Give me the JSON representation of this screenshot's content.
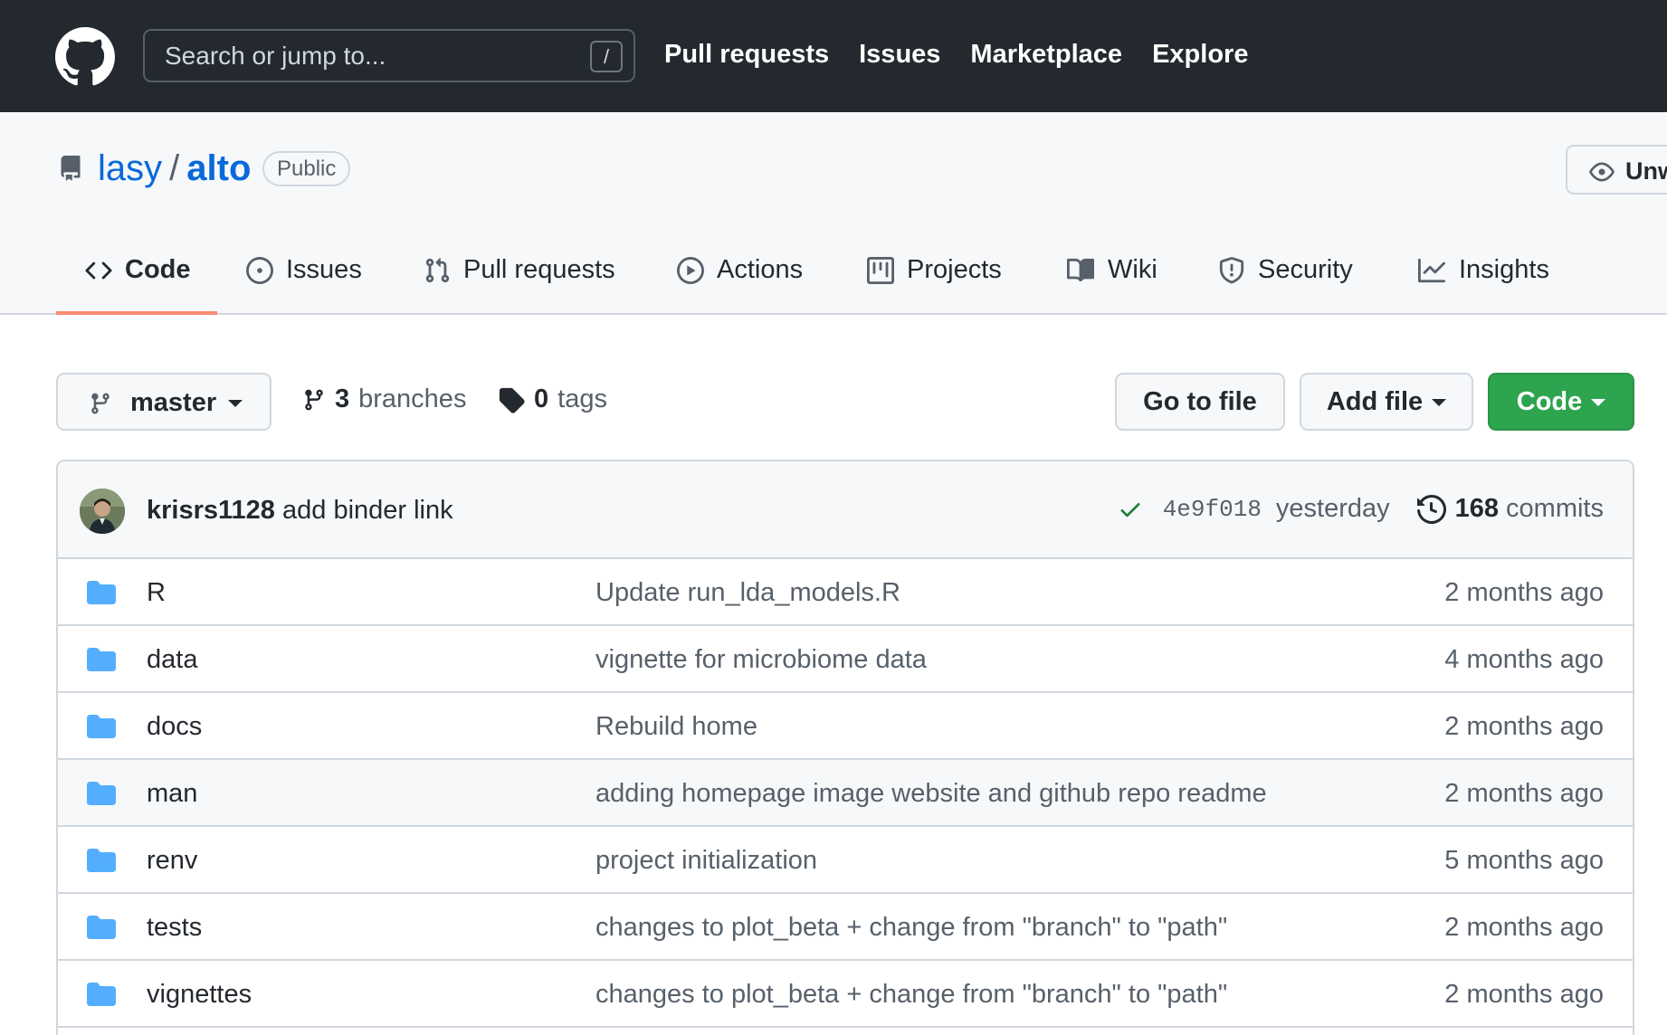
{
  "header": {
    "search_placeholder": "Search or jump to...",
    "search_shortcut": "/",
    "nav": [
      "Pull requests",
      "Issues",
      "Marketplace",
      "Explore"
    ]
  },
  "repo": {
    "owner": "lasy",
    "separator": "/",
    "name": "alto",
    "visibility": "Public",
    "watch_label": "Unwatch"
  },
  "tabs": [
    {
      "label": "Code",
      "icon": "code-icon",
      "selected": true
    },
    {
      "label": "Issues",
      "icon": "issue-opened-icon"
    },
    {
      "label": "Pull requests",
      "icon": "git-pull-request-icon"
    },
    {
      "label": "Actions",
      "icon": "play-icon"
    },
    {
      "label": "Projects",
      "icon": "project-icon"
    },
    {
      "label": "Wiki",
      "icon": "book-icon"
    },
    {
      "label": "Security",
      "icon": "shield-icon"
    },
    {
      "label": "Insights",
      "icon": "graph-icon"
    }
  ],
  "file_nav": {
    "branch": "master",
    "branches_count": "3",
    "branches_label": "branches",
    "tags_count": "0",
    "tags_label": "tags",
    "go_to_file": "Go to file",
    "add_file": "Add file",
    "code": "Code"
  },
  "latest_commit": {
    "author": "krisrs1128",
    "message": "add binder link",
    "status": "success",
    "sha": "4e9f018",
    "when": "yesterday",
    "commits_count": "168",
    "commits_label": "commits"
  },
  "files": [
    {
      "name": "R",
      "message": "Update run_lda_models.R",
      "age": "2 months ago"
    },
    {
      "name": "data",
      "message": "vignette for microbiome data",
      "age": "4 months ago"
    },
    {
      "name": "docs",
      "message": "Rebuild home",
      "age": "2 months ago"
    },
    {
      "name": "man",
      "message": "adding homepage image website and github repo readme",
      "age": "2 months ago"
    },
    {
      "name": "renv",
      "message": "project initialization",
      "age": "5 months ago"
    },
    {
      "name": "tests",
      "message": "changes to plot_beta + change from \"branch\" to \"path\"",
      "age": "2 months ago"
    },
    {
      "name": "vignettes",
      "message": "changes to plot_beta + change from \"branch\" to \"path\"",
      "age": "2 months ago"
    }
  ],
  "colors": {
    "header_bg": "#24292f",
    "link": "#0969da",
    "primary_button": "#2da44e",
    "tab_underline": "#fd8c73",
    "folder": "#54aeff",
    "check": "#1a7f37"
  }
}
